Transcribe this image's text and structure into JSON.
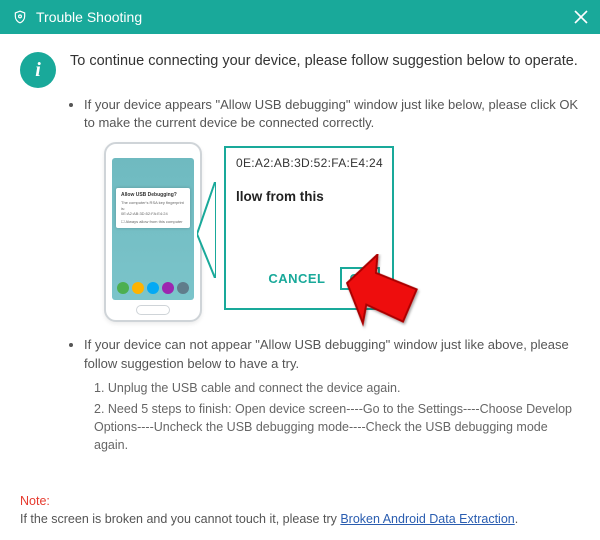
{
  "titlebar": {
    "title": "Trouble Shooting"
  },
  "intro": "To continue connecting your device, please follow suggestion below to operate.",
  "bullets": {
    "b1": "If your device appears \"Allow USB debugging\" window just like below, please click OK to make the current device  be connected correctly.",
    "b2": "If your device can not appear \"Allow USB debugging\" window just like above, please follow suggestion below to have a try."
  },
  "zoom": {
    "mac_line": "0E:A2:AB:3D:52:FA:E4:24",
    "allow_text": "llow from this",
    "cancel": "CANCEL",
    "ok": "OK"
  },
  "phone_popup": {
    "title": "Allow USB Debugging?"
  },
  "steps": {
    "s1": "1. Unplug the USB cable and connect the device again.",
    "s2": "2. Need 5 steps to finish: Open device screen----Go to the Settings----Choose Develop Options----Uncheck the USB debugging mode----Check the USB debugging mode again."
  },
  "note": {
    "label": "Note:",
    "text": "If the screen is broken and you cannot touch it, please try ",
    "link": "Broken Android Data Extraction",
    "suffix": "."
  }
}
